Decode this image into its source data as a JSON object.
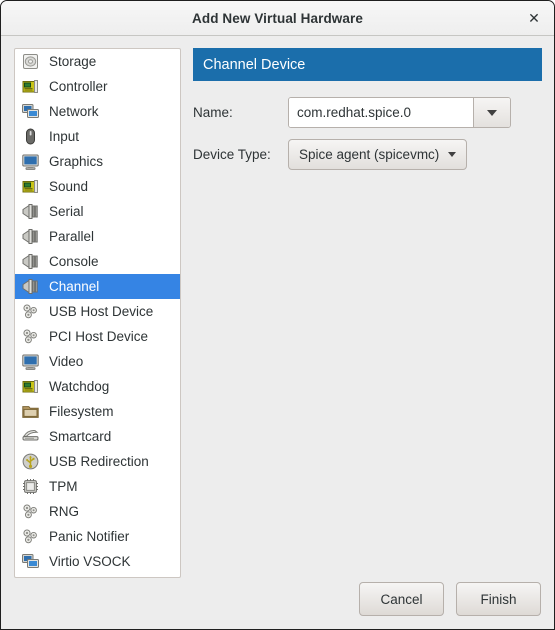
{
  "window": {
    "title": "Add New Virtual Hardware",
    "close_label": "✕"
  },
  "sidebar": {
    "items": [
      {
        "label": "Storage",
        "icon": "storage-icon",
        "selected": false
      },
      {
        "label": "Controller",
        "icon": "controller-card-icon",
        "selected": false
      },
      {
        "label": "Network",
        "icon": "network-icon",
        "selected": false
      },
      {
        "label": "Input",
        "icon": "mouse-icon",
        "selected": false
      },
      {
        "label": "Graphics",
        "icon": "monitor-icon",
        "selected": false
      },
      {
        "label": "Sound",
        "icon": "controller-card-icon",
        "selected": false
      },
      {
        "label": "Serial",
        "icon": "serial-port-icon",
        "selected": false
      },
      {
        "label": "Parallel",
        "icon": "serial-port-icon",
        "selected": false
      },
      {
        "label": "Console",
        "icon": "serial-port-icon",
        "selected": false
      },
      {
        "label": "Channel",
        "icon": "serial-port-icon",
        "selected": true
      },
      {
        "label": "USB Host Device",
        "icon": "gears-icon",
        "selected": false
      },
      {
        "label": "PCI Host Device",
        "icon": "gears-icon",
        "selected": false
      },
      {
        "label": "Video",
        "icon": "monitor-icon",
        "selected": false
      },
      {
        "label": "Watchdog",
        "icon": "controller-card-icon",
        "selected": false
      },
      {
        "label": "Filesystem",
        "icon": "folder-icon",
        "selected": false
      },
      {
        "label": "Smartcard",
        "icon": "smartcard-reader-icon",
        "selected": false
      },
      {
        "label": "USB Redirection",
        "icon": "usb-icon",
        "selected": false
      },
      {
        "label": "TPM",
        "icon": "chip-icon",
        "selected": false
      },
      {
        "label": "RNG",
        "icon": "gears-icon",
        "selected": false
      },
      {
        "label": "Panic Notifier",
        "icon": "gears-icon",
        "selected": false
      },
      {
        "label": "Virtio VSOCK",
        "icon": "network-icon",
        "selected": false
      }
    ]
  },
  "pane": {
    "header": "Channel Device",
    "fields": {
      "name_label": "Name:",
      "name_value": "com.redhat.spice.0",
      "device_type_label": "Device Type:",
      "device_type_value": "Spice agent (spicevmc)"
    }
  },
  "footer": {
    "cancel_label": "Cancel",
    "finish_label": "Finish"
  },
  "colors": {
    "header_blue": "#1b6eab",
    "selection_blue": "#3584e4",
    "window_bg": "#ededed",
    "text": "#2e3436"
  }
}
